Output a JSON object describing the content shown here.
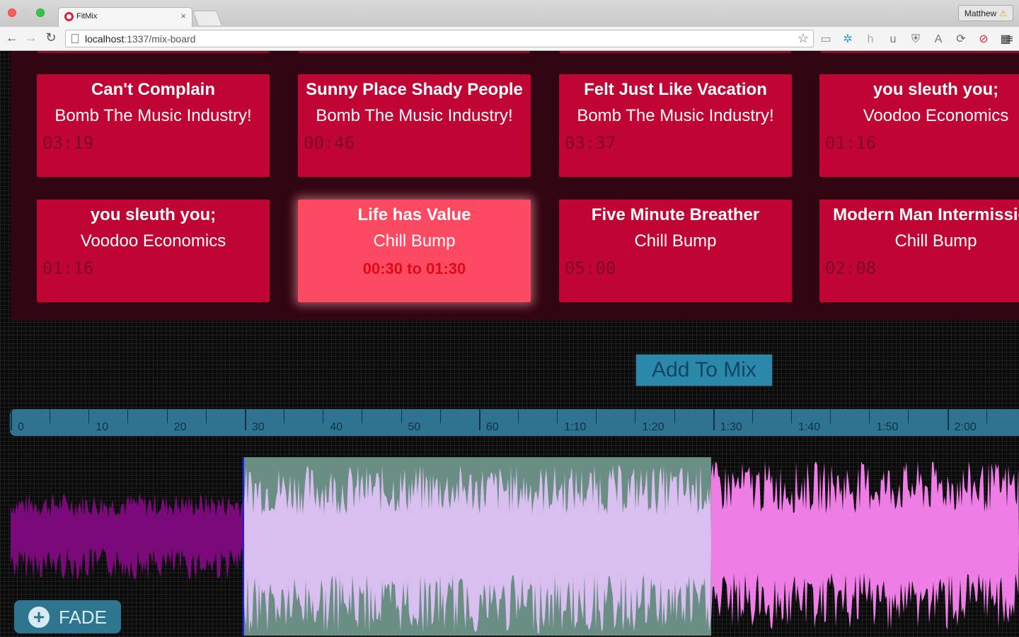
{
  "browser": {
    "tab_title": "FitMix",
    "tab_close": "×",
    "profile_name": "Matthew",
    "profile_warning": "⚠",
    "url_host": "localhost",
    "url_path": ":1337/mix-board",
    "back": "←",
    "forward": "→",
    "reload": "↻",
    "star": "☆",
    "extensions": [
      {
        "name": "cast-icon",
        "glyph": "▭",
        "color": "#888"
      },
      {
        "name": "network-icon",
        "glyph": "✲",
        "color": "#2a9fd6"
      },
      {
        "name": "h-icon",
        "glyph": "h",
        "color": "#aaa"
      },
      {
        "name": "ublock-icon",
        "glyph": "u",
        "color": "#777"
      },
      {
        "name": "shield-icon",
        "glyph": "⛨",
        "color": "#777"
      },
      {
        "name": "angular-icon",
        "glyph": "A",
        "color": "#777"
      },
      {
        "name": "sync-icon",
        "glyph": "⟳",
        "color": "#666"
      },
      {
        "name": "block-icon",
        "glyph": "⊘",
        "color": "#d9233b"
      },
      {
        "name": "film-icon",
        "glyph": "▦",
        "color": "#333"
      },
      {
        "name": "menu-icon",
        "glyph": "≡",
        "color": "#333"
      }
    ]
  },
  "songs": [
    {
      "title": "Can't Complain",
      "artist": "Bomb The Music Industry!",
      "time": "03:19"
    },
    {
      "title": "Sunny Place Shady People",
      "artist": "Bomb The Music Industry!",
      "time": "00:46"
    },
    {
      "title": "Felt Just Like Vacation",
      "artist": "Bomb The Music Industry!",
      "time": "03:37"
    },
    {
      "title": "you sleuth you;",
      "artist": "Voodoo Economics",
      "time": "01:16"
    },
    {
      "title": "you sleuth you;",
      "artist": "Voodoo Economics",
      "time": "01:16"
    },
    {
      "title": "Life has Value",
      "artist": "Chill Bump",
      "time": "00:30 to 01:30",
      "selected": true
    },
    {
      "title": "Five Minute Breather",
      "artist": "Chill Bump",
      "time": "05:00"
    },
    {
      "title": "Modern Man Intermission",
      "artist": "Chill Bump",
      "time": "02:08"
    }
  ],
  "add_button": "Add To Mix",
  "timeline": {
    "labels": [
      "0",
      "10",
      "20",
      "30",
      "40",
      "50",
      "60",
      "1:10",
      "1:20",
      "1:30",
      "1:40",
      "1:50",
      "2:00"
    ]
  },
  "fade_button": {
    "label": "FADE",
    "icon": "+"
  },
  "colors": {
    "card": "#c00434",
    "card_selected": "#fb4a62",
    "board": "#310511",
    "wave_left": "#7a0a7a",
    "wave_selected": "#d9bff0",
    "selection_bg": "#6a8e84",
    "wave_right": "#ee7ee6",
    "accent_blue": "#2f7390"
  }
}
